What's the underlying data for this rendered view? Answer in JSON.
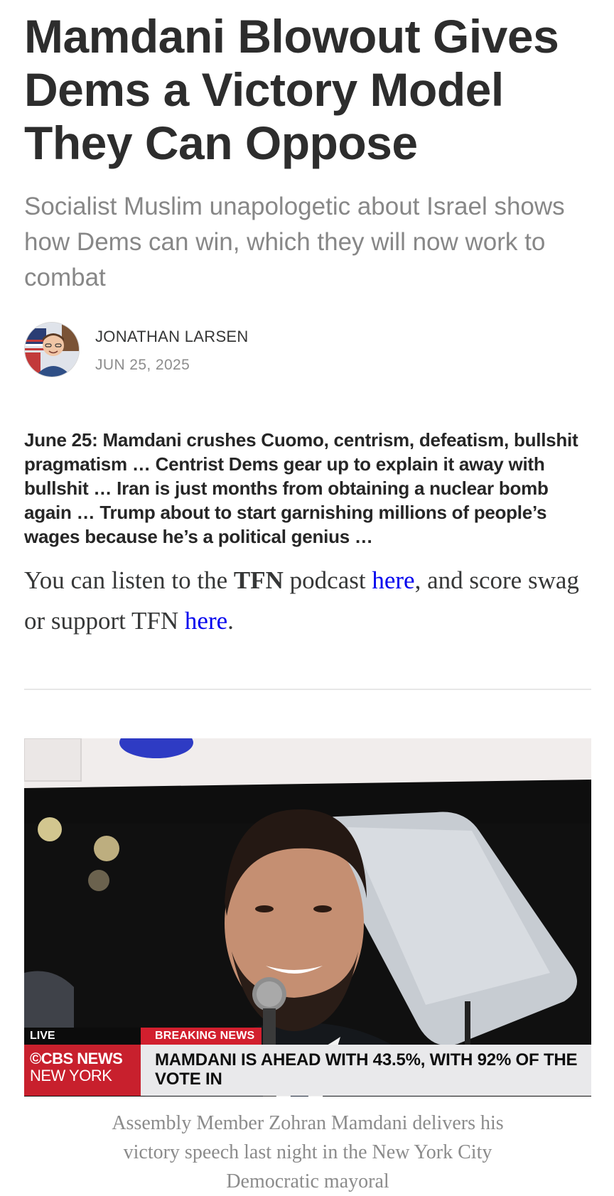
{
  "post": {
    "title": "Mamdani Blowout Gives Dems a Victory Model They Can Oppose",
    "subtitle": "Socialist Muslim unapologetic about Israel shows how Dems can win, which they will now work to combat",
    "author": {
      "name": "JONATHAN LARSEN",
      "date": "JUN 25, 2025",
      "avatar_icon": "author-avatar"
    },
    "lead": "June 25: Mamdani crushes Cuomo, centrism, defeatism, bullshit pragmatism … Centrist Dems gear up to explain it away with bullshit … Iran is just months from obtaining a nuclear bomb again … Trump about to start garnishing millions of people’s wages because he’s a political genius …",
    "body": {
      "part1": "You can listen to the ",
      "brand": "TFN",
      "part2": " podcast ",
      "link1": "here",
      "part3": ", and score swag or support TFN ",
      "link2": "here",
      "part4": "."
    },
    "image": {
      "chyron_live": "LIVE",
      "chyron_breaking": "BREAKING NEWS",
      "chyron_network_line1": "©CBS NEWS",
      "chyron_network_line2": "NEW YORK",
      "chyron_headline": "MAMDANI IS AHEAD WITH 43.5%, WITH 92% OF THE VOTE IN"
    },
    "caption": "Assembly Member Zohran Mamdani delivers his victory speech last night in the New York City Democratic mayoral"
  },
  "colors": {
    "link": "#0000ee",
    "title": "#2d2d2d",
    "subtitle": "#878787",
    "chyron_red": "#c8202d"
  }
}
